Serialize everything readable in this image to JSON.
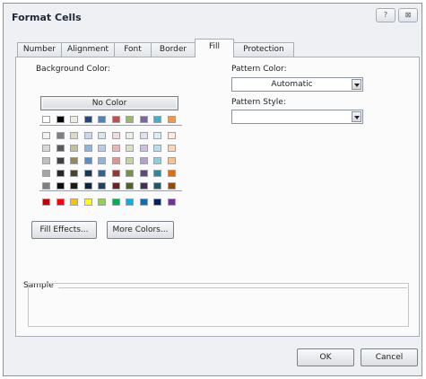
{
  "dialog": {
    "title": "Format Cells"
  },
  "titlebar": {
    "help_glyph": "?",
    "close_glyph": "⊠"
  },
  "tabs": [
    {
      "label": "Number"
    },
    {
      "label": "Alignment"
    },
    {
      "label": "Font"
    },
    {
      "label": "Border"
    },
    {
      "label": "Fill"
    },
    {
      "label": "Protection"
    }
  ],
  "active_tab": "Fill",
  "fill": {
    "background_color_label": "Background Color:",
    "no_color_button": "No Color",
    "fill_effects_button": "Fill Effects...",
    "more_colors_button": "More Colors...",
    "pattern_color_label": "Pattern Color:",
    "pattern_color_value": "Automatic",
    "pattern_style_label": "Pattern Style:",
    "pattern_style_value": "",
    "sample_label": "Sample"
  },
  "palette": {
    "theme_top": [
      "#ffffff",
      "#000000",
      "#eeece1",
      "#1f497d",
      "#4f81bd",
      "#c0504d",
      "#9bbb59",
      "#8064a2",
      "#4bacc6",
      "#f79646"
    ],
    "theme_rows": [
      [
        "#f2f2f2",
        "#7f7f7f",
        "#ddd9c3",
        "#c6d9f0",
        "#dbe5f1",
        "#f2dcdb",
        "#ebf1dd",
        "#e5e0ec",
        "#dbeef3",
        "#fdeada"
      ],
      [
        "#d8d8d8",
        "#595959",
        "#c4bd97",
        "#8db3e2",
        "#b8cce4",
        "#e5b9b7",
        "#d7e3bc",
        "#ccc1d9",
        "#b7dde8",
        "#fbd5b5"
      ],
      [
        "#bfbfbf",
        "#3f3f3f",
        "#938953",
        "#548dd4",
        "#95b3d7",
        "#d99694",
        "#c3d69b",
        "#b2a2c7",
        "#92cddc",
        "#fac08f"
      ],
      [
        "#a5a5a5",
        "#262626",
        "#494429",
        "#17365d",
        "#366092",
        "#953734",
        "#76923c",
        "#5f497a",
        "#31859b",
        "#e36c09"
      ],
      [
        "#7f7f7f",
        "#0c0c0c",
        "#1d1b10",
        "#0f243e",
        "#244061",
        "#632423",
        "#4f6128",
        "#3f3151",
        "#205867",
        "#974806"
      ]
    ],
    "standard": [
      "#c00000",
      "#ff0000",
      "#ffc000",
      "#ffff00",
      "#92d050",
      "#00b050",
      "#00b0f0",
      "#0070c0",
      "#002060",
      "#7030a0"
    ]
  },
  "footer": {
    "ok_button": "OK",
    "cancel_button": "Cancel"
  }
}
